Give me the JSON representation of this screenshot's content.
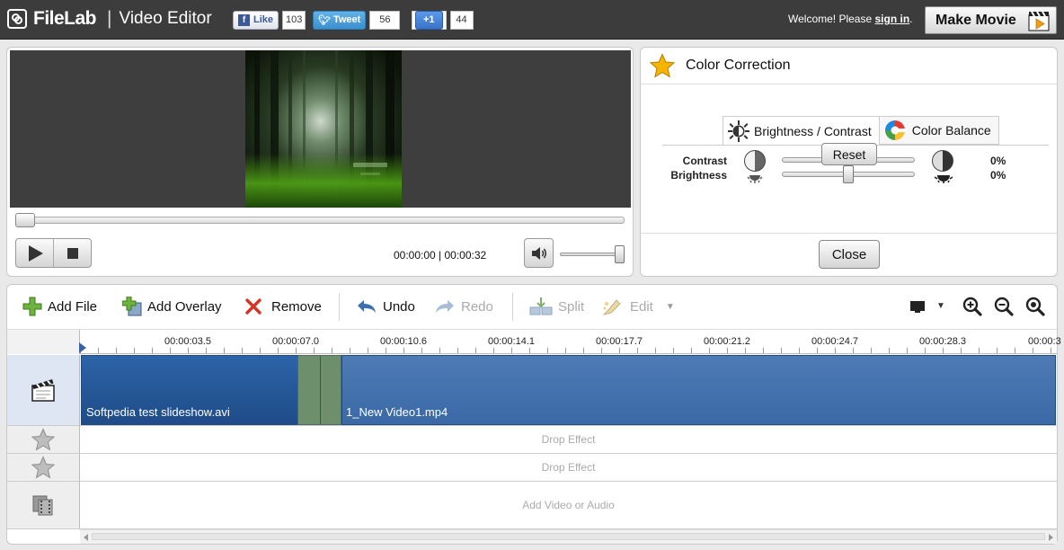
{
  "header": {
    "brand": "FileLab",
    "separator": "|",
    "product": "Video Editor",
    "social": {
      "like_label": "Like",
      "like_count": "103",
      "tweet_label": "Tweet",
      "tweet_count": "56",
      "plusone_label": "+1",
      "plusone_count": "44"
    },
    "welcome_text": "Welcome! Please ",
    "sign_in_label": "sign in",
    "welcome_suffix": ".",
    "make_movie_label": "Make Movie"
  },
  "preview": {
    "timecode": "00:00:00 | 00:00:32",
    "seek_position": 0,
    "volume_level": 1.0
  },
  "color_correction": {
    "title": "Color Correction",
    "tabs": [
      {
        "label": "Brightness / Contrast",
        "active": true
      },
      {
        "label": "Color Balance",
        "active": false
      }
    ],
    "contrast_label": "Contrast",
    "brightness_label": "Brightness",
    "contrast_value": "0%",
    "brightness_value": "0%",
    "reset_label": "Reset",
    "close_label": "Close"
  },
  "toolbar": {
    "add_file": "Add File",
    "add_overlay": "Add Overlay",
    "remove": "Remove",
    "undo": "Undo",
    "redo": "Redo",
    "split": "Split",
    "edit": "Edit"
  },
  "timeline": {
    "ticks": [
      "00:00:03.5",
      "00:00:07.0",
      "00:00:10.6",
      "00:00:14.1",
      "00:00:17.7",
      "00:00:21.2",
      "00:00:24.7",
      "00:00:28.3",
      "00:00:3"
    ],
    "clips": [
      {
        "name": "Softpedia test slideshow.avi"
      },
      {
        "name": "1_New Video1.mp4"
      }
    ],
    "effect_track_1": "Drop Effect",
    "effect_track_2": "Drop Effect",
    "audio_track": "Add Video or Audio"
  },
  "colors": {
    "topbar": "#3c3c3c",
    "clip_primary": "#2c63a8",
    "clip_secondary": "#4e7bb5",
    "transition": "#6e8f6b",
    "accent_star": "#f5b400"
  },
  "icons": [
    "filelab-logo-icon",
    "clapperboard-icon",
    "gold-star-icon",
    "brightness-icon",
    "color-wheel-icon",
    "add-icon",
    "add-overlay-icon",
    "remove-icon",
    "undo-icon",
    "redo-icon",
    "split-icon",
    "edit-icon",
    "monitor-icon",
    "zoom-in-icon",
    "zoom-out-icon",
    "zoom-fit-icon",
    "star-icon",
    "filmstrip-icon",
    "speaker-icon"
  ]
}
